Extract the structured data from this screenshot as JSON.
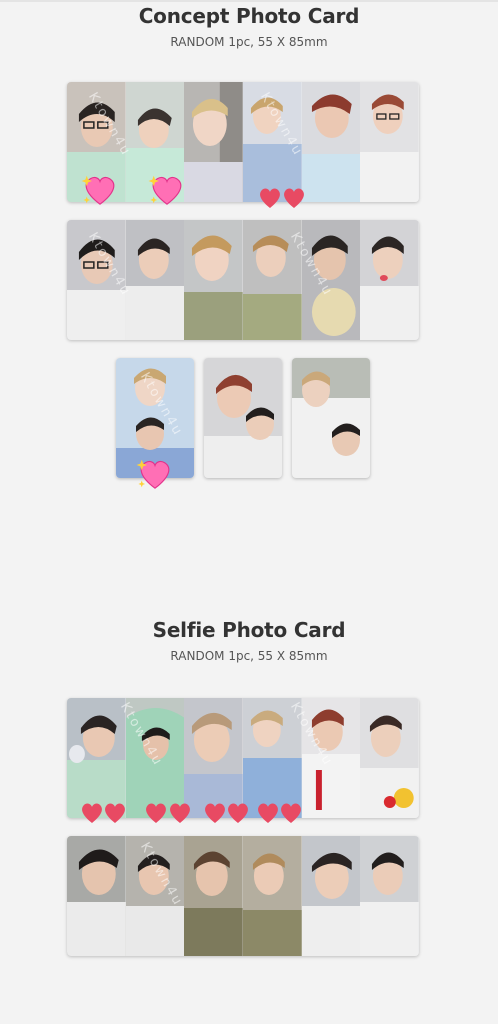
{
  "concept": {
    "title": "Concept Photo Card",
    "subtitle": "RANDOM 1pc, 55 X 85mm"
  },
  "selfie": {
    "title": "Selfie Photo Card",
    "subtitle": "RANDOM 1pc, 55 X 85mm"
  },
  "watermark_text": "Ktown4u",
  "colors": {
    "page_bg": "#f3f3f3",
    "heart_red": "#e84a63",
    "heart_pink": "#ff6fb5",
    "sparkle_yellow": "#ffd23a"
  }
}
